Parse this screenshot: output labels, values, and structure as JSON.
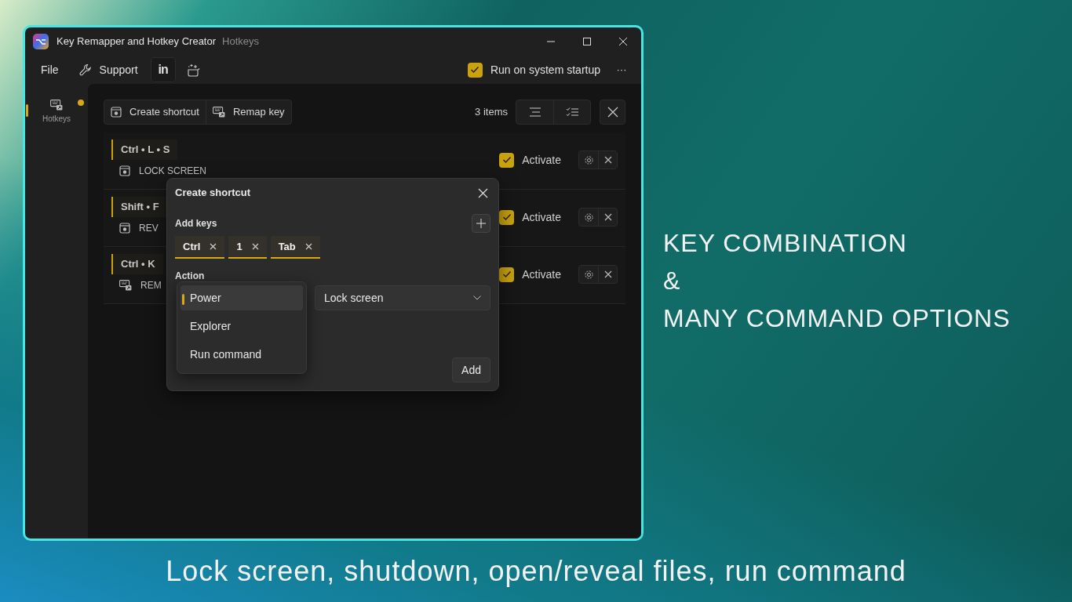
{
  "window": {
    "title": "Key Remapper and Hotkey Creator",
    "subtitle": "Hotkeys"
  },
  "menu": [
    {
      "kind": "text",
      "label": "File"
    },
    {
      "kind": "support",
      "label": "Support"
    },
    {
      "kind": "linkedin",
      "label": "in"
    },
    {
      "kind": "sparkle"
    }
  ],
  "startup": {
    "label": "Run on system startup",
    "checked": true
  },
  "more": "···",
  "sidebar": [
    {
      "label": "Hotkeys",
      "selected": true,
      "notification": true
    }
  ],
  "toolbar": {
    "buttons": [
      {
        "kind": "shortcut",
        "label": "Create shortcut"
      },
      {
        "kind": "remap",
        "label": "Remap key"
      }
    ],
    "count": "3 items"
  },
  "hotkeys": [
    {
      "keys": "Ctrl • L • S",
      "kind": "shortcut",
      "action": "LOCK SCREEN",
      "activate": "Activate",
      "active": true
    },
    {
      "keys": "Shift • F",
      "kind": "shortcut",
      "action": "REV",
      "activate": "Activate",
      "active": true
    },
    {
      "keys": "Ctrl • K",
      "kind": "remap",
      "action": "REM",
      "activate": "Activate",
      "active": true
    }
  ],
  "dialog": {
    "title": "Create shortcut",
    "keys_label": "Add keys",
    "keys": [
      "Ctrl",
      "1",
      "Tab"
    ],
    "action_label": "Action",
    "categories": [
      {
        "label": "Power",
        "selected": true
      },
      {
        "label": "Explorer",
        "selected": false
      },
      {
        "label": "Run command",
        "selected": false
      }
    ],
    "command": "Lock screen",
    "add": "Add"
  },
  "promo": {
    "headline": [
      "KEY COMBINATION",
      "&",
      "MANY COMMAND OPTIONS"
    ],
    "caption": "Lock screen, shutdown, open/reveal files, run command"
  }
}
